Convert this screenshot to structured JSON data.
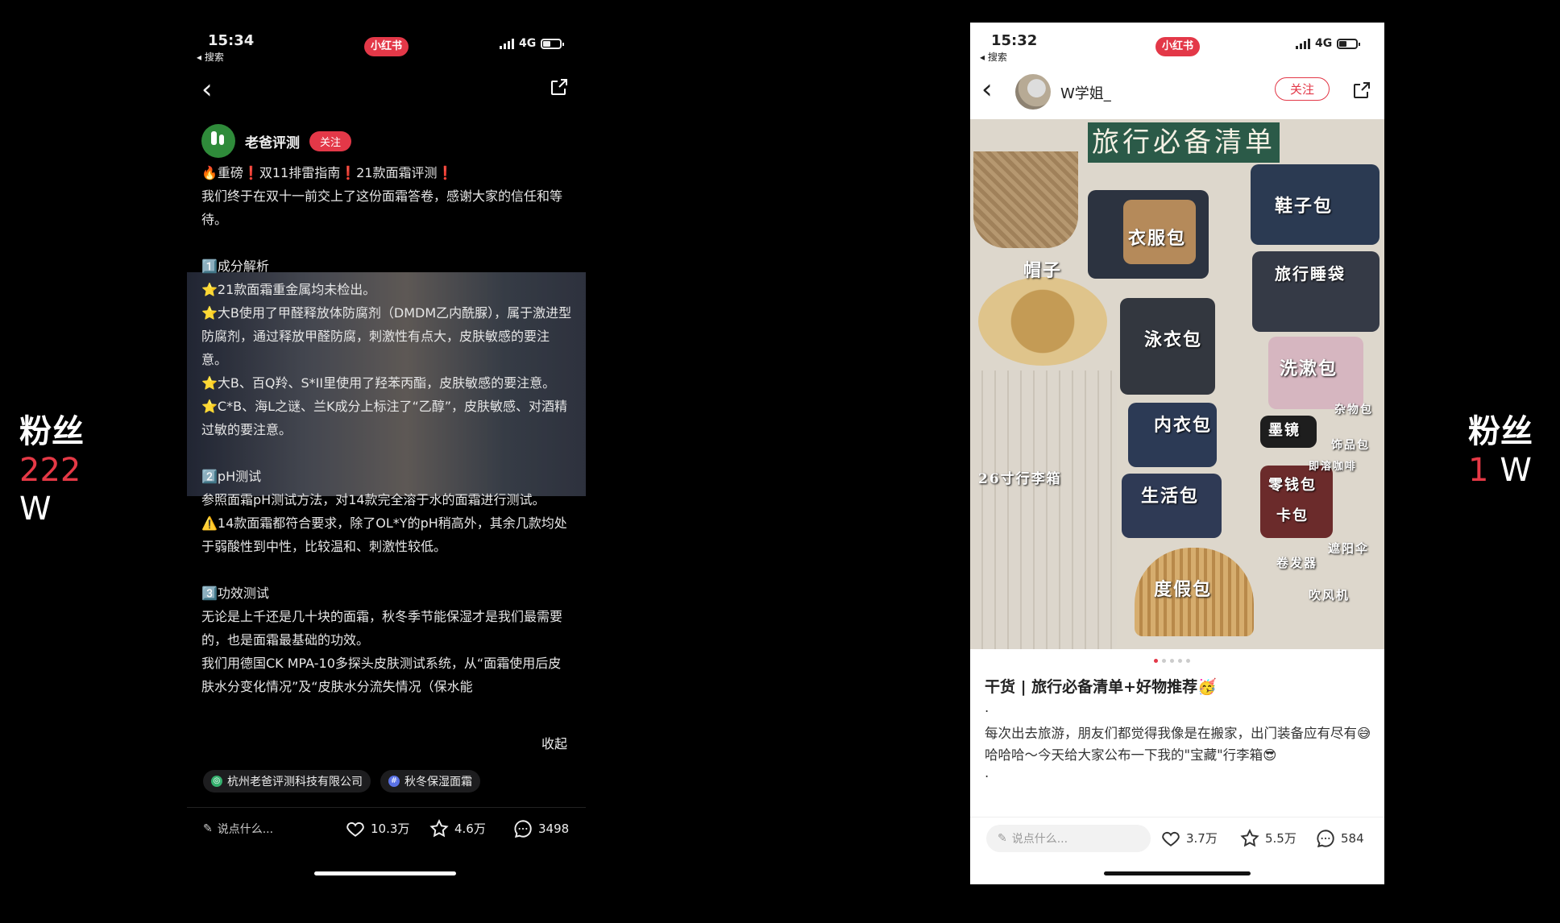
{
  "left_caption": {
    "title": "粉丝",
    "number": "222",
    "unit": "W"
  },
  "right_caption": {
    "title": "粉丝",
    "number": "1",
    "unit": "W"
  },
  "left_phone": {
    "status": {
      "time": "15:34",
      "back_label": "◂ 搜索",
      "app_badge": "小红书",
      "network": "4G"
    },
    "author": {
      "name": "老爸评测",
      "follow_label": "关注"
    },
    "lines": [
      "🔥重磅❗双11排雷指南❗21款面霜评测❗",
      "我们终于在双十一前交上了这份面霜答卷，感谢大家的信任和等待。",
      "",
      "1️⃣成分解析",
      "⭐21款面霜重金属均未检出。",
      "⭐大B使用了甲醛释放体防腐剂（DMDM乙内酰脲），属于激进型防腐剂，通过释放甲醛防腐，刺激性有点大，皮肤敏感的要注意。",
      "⭐大B、百Q羚、S*II里使用了羟苯丙酯，皮肤敏感的要注意。",
      "⭐C*B、海L之谜、兰K成分上标注了“乙醇”，皮肤敏感、对酒精过敏的要注意。",
      "",
      "2️⃣pH测试",
      "参照面霜pH测试方法，对14款完全溶于水的面霜进行测试。",
      "⚠️14款面霜都符合要求，除了OL*Y的pH稍高外，其余几款均处于弱酸性到中性，比较温和、刺激性较低。",
      "",
      "3️⃣功效测试",
      "无论是上千还是几十块的面霜，秋冬季节能保湿才是我们最需要的，也是面霜最基础的功效。",
      "我们用德国CK MPA-10多探头皮肤测试系统，从“面霜使用后皮肤水分变化情况”及“皮肤水分流失情况（保水能"
    ],
    "collapse_label": "收起",
    "tags": [
      "杭州老爸评测科技有限公司",
      "秋冬保湿面霜"
    ],
    "bottom": {
      "comment_placeholder": "说点什么...",
      "likes": "10.3万",
      "stars": "4.6万",
      "comments": "3498"
    }
  },
  "right_phone": {
    "status": {
      "time": "15:32",
      "back_label": "◂ 搜索",
      "app_badge": "小红书",
      "network": "4G"
    },
    "author": {
      "name": "W学姐_",
      "follow_label": "关注"
    },
    "cover": {
      "title": "旅行必备清单",
      "labels": [
        "帽子",
        "衣服包",
        "鞋子包",
        "旅行睡袋",
        "泳衣包",
        "洗漱包",
        "内衣包",
        "墨镜",
        "杂物包",
        "饰品包",
        "26寸行李箱",
        "生活包",
        "零钱包",
        "卡包",
        "度假包",
        "卷发器",
        "吹风机",
        "遮阳伞",
        "即溶咖啡"
      ]
    },
    "title": "干货 | 旅行必备清单+好物推荐🥳",
    "body": [
      "·",
      "每次出去旅游，朋友们都觉得我像是在搬家，出门装备应有尽有😅",
      "哈哈哈～今天给大家公布一下我的\"宝藏\"行李箱😎",
      "·"
    ],
    "bottom": {
      "comment_placeholder": "说点什么...",
      "likes": "3.7万",
      "stars": "5.5万",
      "comments": "584"
    }
  },
  "colors": {
    "accent_red": "#e33848"
  }
}
